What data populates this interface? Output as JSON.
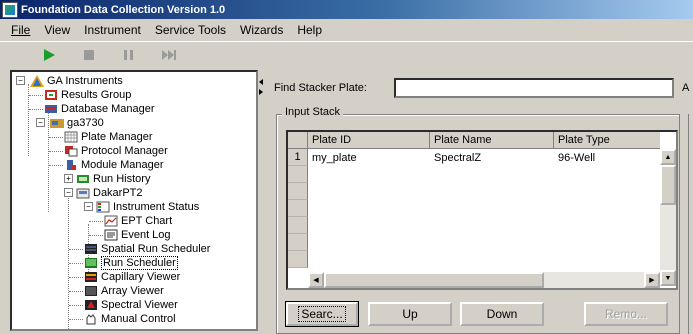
{
  "window": {
    "title": "Foundation Data Collection Version 1.0"
  },
  "menu": [
    "File",
    "View",
    "Instrument",
    "Service Tools",
    "Wizards",
    "Help"
  ],
  "toolbar": {
    "buttons": [
      "play-icon",
      "stop-icon",
      "pause-icon",
      "skip-icon"
    ]
  },
  "tree": {
    "items": [
      {
        "label": "GA Instruments"
      },
      {
        "label": "Results Group"
      },
      {
        "label": "Database Manager"
      },
      {
        "label": "ga3730"
      },
      {
        "label": "Plate Manager"
      },
      {
        "label": "Protocol Manager"
      },
      {
        "label": "Module Manager"
      },
      {
        "label": "Run History"
      },
      {
        "label": "DakarPT2"
      },
      {
        "label": "Instrument Status"
      },
      {
        "label": "EPT Chart"
      },
      {
        "label": "Event Log"
      },
      {
        "label": "Spatial Run Scheduler"
      },
      {
        "label": "Run Scheduler"
      },
      {
        "label": "Capillary Viewer"
      },
      {
        "label": "Array Viewer"
      },
      {
        "label": "Spectral Viewer"
      },
      {
        "label": "Manual Control"
      }
    ],
    "selected": "Run Scheduler"
  },
  "main": {
    "find_label": "Find Stacker Plate:",
    "find_value": "",
    "find_extra": "A",
    "group_title": "Input Stack",
    "columns": [
      "Plate ID",
      "Plate Name",
      "Plate Type"
    ],
    "rows": [
      {
        "num": "1",
        "plate_id": "my_plate",
        "plate_name": "SpectralZ",
        "plate_type": "96-Well"
      }
    ],
    "buttons": {
      "search": "Searc...",
      "up": "Up",
      "down": "Down",
      "remove": "Remo..."
    }
  },
  "colors": {
    "title_start": "#0a246a",
    "title_end": "#a6caf0",
    "face": "#d4d0c8"
  }
}
